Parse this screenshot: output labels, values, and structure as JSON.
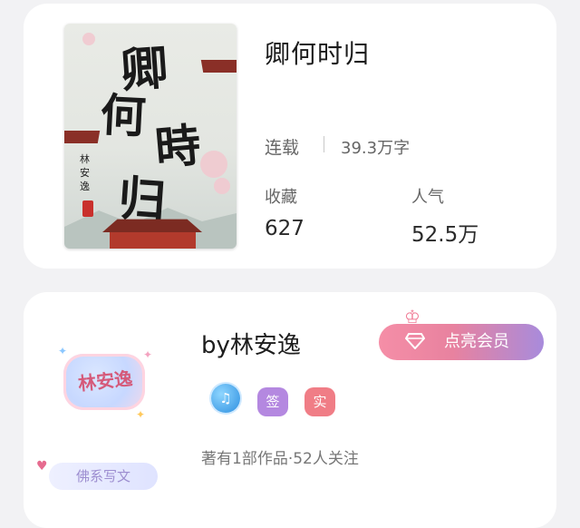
{
  "book": {
    "title": "卿何时归",
    "cover": {
      "title_chars": [
        "卿",
        "何",
        "時",
        "归"
      ],
      "author_vertical": "林安逸",
      "seal_char": "印"
    },
    "status": "连载",
    "word_count": "39.3万字",
    "stats": [
      {
        "label": "收藏",
        "value": "627"
      },
      {
        "label": "人气",
        "value": "52.5万"
      }
    ]
  },
  "author": {
    "name": "by林安逸",
    "avatar_text": "林安逸",
    "tag": "佛系写文",
    "vip_button": "点亮会员",
    "badges": [
      {
        "name": "music-note-icon",
        "glyph": "♫"
      },
      {
        "name": "sign-badge",
        "glyph": "签"
      },
      {
        "name": "real-badge",
        "glyph": "实"
      }
    ],
    "meta": "著有1部作品·52人关注"
  },
  "colors": {
    "background": "#f2f2f4",
    "vip_gradient_start": "#f58ea7",
    "vip_gradient_end": "#a88bdc",
    "sign_badge": "#b488e0",
    "real_badge": "#f07d86"
  }
}
